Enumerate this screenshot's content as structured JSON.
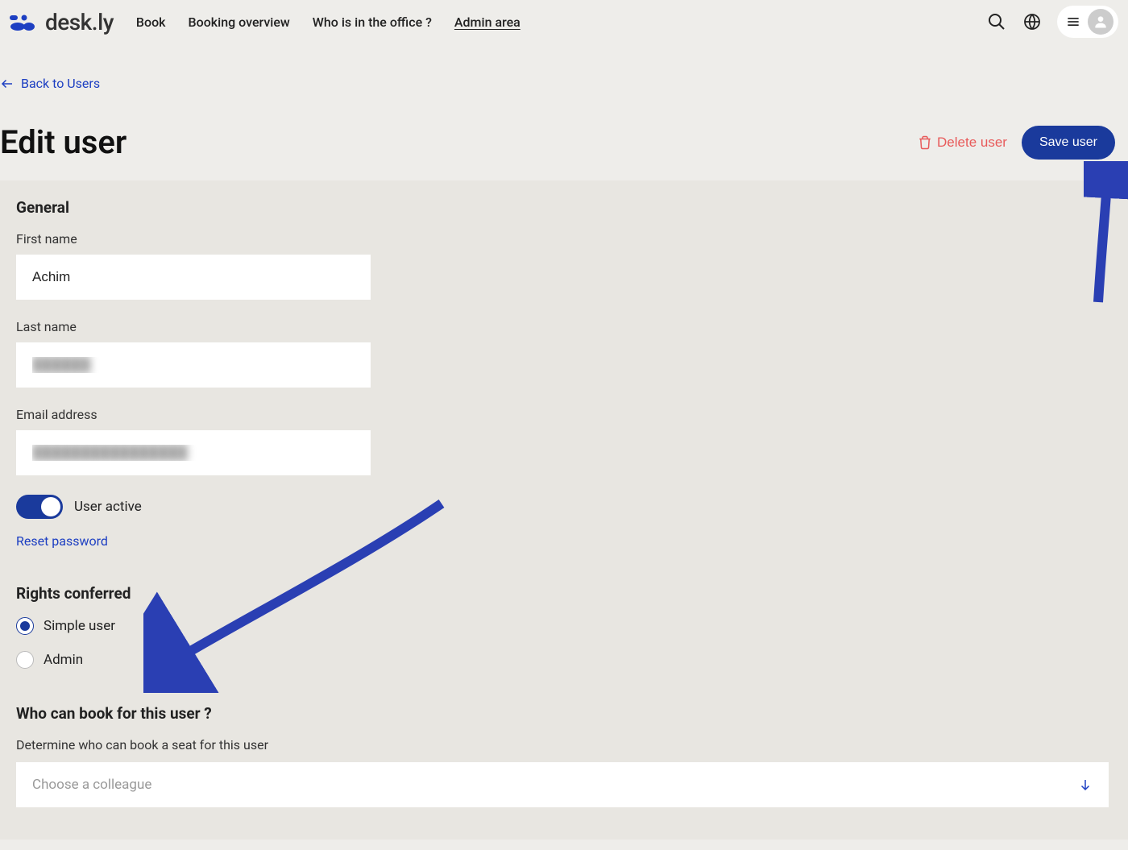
{
  "brand": {
    "name": "desk.ly"
  },
  "nav": {
    "book": "Book",
    "booking_overview": "Booking overview",
    "who_office": "Who is in the office ?",
    "admin_area": "Admin area"
  },
  "back_link": "Back to Users",
  "page_title": "Edit user",
  "actions": {
    "delete": "Delete user",
    "save": "Save user"
  },
  "general": {
    "title": "General",
    "first_name_label": "First name",
    "first_name_value": "Achim",
    "last_name_label": "Last name",
    "last_name_value": "██████",
    "email_label": "Email address",
    "email_value": "████████████████",
    "user_active_label": "User active",
    "reset_password": "Reset password"
  },
  "rights": {
    "title": "Rights conferred",
    "simple_user": "Simple user",
    "admin": "Admin"
  },
  "book_for": {
    "title": "Who can book for this user ?",
    "helper": "Determine who can book a seat for this user",
    "placeholder": "Choose a colleague"
  }
}
